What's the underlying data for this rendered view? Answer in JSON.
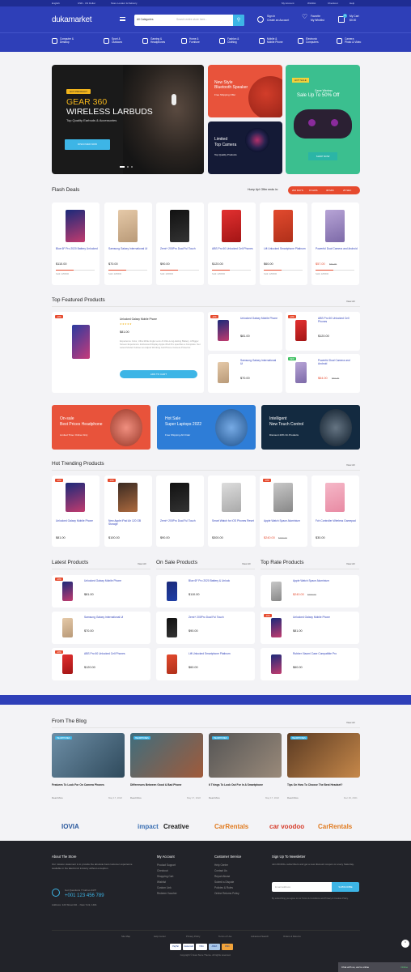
{
  "topbar": {
    "left": [
      "English",
      "USD - US Dollar",
      "Store Locator & Delivery"
    ],
    "right": [
      "My Account",
      "Wishlist",
      "Checkout",
      "Help"
    ]
  },
  "header": {
    "logo": "dukamarket",
    "search": {
      "category": "All Categories",
      "placeholder": "Search entire store here..."
    },
    "account": {
      "line1": "Sign In",
      "line2": "Create an Account"
    },
    "wishlist": {
      "line1": "Favorite",
      "line2": "My Wishlist"
    },
    "cart": {
      "line1": "My Cart",
      "line2": "$0.00",
      "count": "0"
    }
  },
  "categories": [
    {
      "l1": "Computer &",
      "l2": "Desktop"
    },
    {
      "l1": "Sport &",
      "l2": "Outdoors"
    },
    {
      "l1": "Gaming &",
      "l2": "Headphones"
    },
    {
      "l1": "Home &",
      "l2": "Furniture"
    },
    {
      "l1": "Fashion &",
      "l2": "Clothing"
    },
    {
      "l1": "Mobile &",
      "l2": "Mobile Phone"
    },
    {
      "l1": "Electronic",
      "l2": "Computers"
    },
    {
      "l1": "Camera",
      "l2": "Photo & Video"
    }
  ],
  "hero": {
    "tag": "HOT PRODUCT",
    "line1": "GEAR 360",
    "line2": "WIRELESS LARBUDS",
    "sub": "Top Quality Earbuds & Accessories",
    "cta": "DISCOVER NOW"
  },
  "banners": {
    "speaker": {
      "l1": "New Style",
      "l2": "Bluetooth Speaker",
      "l3": "Free Shipping Offer"
    },
    "camera": {
      "l1": "Limited",
      "l2": "Top Camera",
      "l3": "Top Quality Products"
    },
    "gamepad": {
      "tag": "HOT SALE",
      "l1": "Game Wireless",
      "l2": "Sale Up To 50% Off",
      "cta": "SHOP NOW"
    }
  },
  "flash": {
    "title": "Flash Deals",
    "offer": "Hurry Up! Offer ends in:",
    "timer": [
      "202 DAYS",
      "15 HRS",
      "38 MIN",
      "25 SEC"
    ],
    "products": [
      {
        "name": "Blue 6F Pro 2020 Battery Unlocked",
        "price": "$110.00",
        "sold": "Sold: 225/500",
        "fill": 0.45
      },
      {
        "name": "Samsung Galaxy International Ui",
        "price": "$70.00",
        "sold": "Sold: 225/500",
        "fill": 0.45
      },
      {
        "name": "Zemi+ 200Pro Dual Ful Touch",
        "price": "$90.00",
        "sold": "Sold: 225/500",
        "fill": 0.45
      },
      {
        "name": "ABS Pro 60 Unlocked Cell Phones",
        "price": "$120.00",
        "sold": "Sold: 225/500",
        "fill": 0.45
      },
      {
        "name": "Lift Unlocked Smartphone Platinum",
        "price": "$60.00",
        "sold": "Sold: 225/500",
        "fill": 0.45
      },
      {
        "name": "Powerful Dual Camera and Android",
        "price": "$57.00",
        "old": "$62.00",
        "sold": "Sold: 225/500",
        "fill": 0.45
      }
    ]
  },
  "featured": {
    "title": "Top Featured Products",
    "view": "View All",
    "main": {
      "badge": "-10%",
      "name": "Unlocked Galaxy Mobile Phone",
      "price": "$81.00",
      "desc": "Experience Color, Ultra-Wide Angle Lens & Ultra-Long-lasting Battery. A Bigger Screen Experience: Enhanced Display Apple iPod Pro specifies a Complete. Set Latest Model Outdoor as Adjust Working Cell Phone Camera Protector.",
      "cta": "ADD TO CART"
    },
    "items": [
      {
        "badge": "-10%",
        "name": "Unlocked Galaxy Mobile Phone",
        "price": "$81.00"
      },
      {
        "badge": "-10%",
        "name": "ABS Pro 60 Unlocked Cell Phones",
        "price": "$120.00"
      },
      {
        "badge": "",
        "name": "Samsung Galaxy International Ui",
        "price": "$70.00"
      },
      {
        "badge": "NEW",
        "name": "Powerful Dual Camera and Android",
        "price": "$64.00",
        "old": "$66.00"
      }
    ]
  },
  "promos": [
    {
      "l1": "On-sale",
      "l2": "Best Prices Headphone",
      "l3": "Limited Time: Online Only"
    },
    {
      "l1": "Hot Sale",
      "l2": "Super Laptops 2022",
      "l3": "Free Shipping All Order"
    },
    {
      "l1": "Intelligent",
      "l2": "New Touch Control",
      "l3": "Discount 20% On Products"
    }
  ],
  "trending": {
    "title": "Hot Trending Products",
    "view": "View All",
    "products": [
      {
        "badge": "-10%",
        "name": "Unlocked Galaxy Mobile Phone",
        "price": "$81.00"
      },
      {
        "badge": "-10%",
        "name": "New Apple iPad Air 120 GB Storage",
        "price": "$100.00"
      },
      {
        "badge": "",
        "name": "Zemi+ 200Pro Dual Ful Touch",
        "price": "$90.00"
      },
      {
        "badge": "",
        "name": "Smart Watch for iOS Phones Reset",
        "price": "$300.00"
      },
      {
        "badge": "-10%",
        "name": "Apple Watch Space Aluminium",
        "price": "$240.00",
        "old": "$260.00"
      },
      {
        "badge": "",
        "name": "Fch Controller Wireless Gamepad",
        "price": "$30.00"
      }
    ]
  },
  "lists": [
    {
      "title": "Latest Products",
      "view": "View All",
      "items": [
        {
          "badge": "-10%",
          "name": "Unlocked Galaxy Mobile Phone",
          "price": "$81.00"
        },
        {
          "badge": "",
          "name": "Samsung Galaxy International Ui",
          "price": "$70.00"
        },
        {
          "badge": "-10%",
          "name": "ABS Pro 60 Unlocked Cell Phones",
          "price": "$120.00"
        }
      ]
    },
    {
      "title": "On Sale Products",
      "view": "View All",
      "items": [
        {
          "badge": "",
          "name": "Blue 6F Pro 2020 Battery & Unlock",
          "price": "$110.00"
        },
        {
          "badge": "",
          "name": "Zemi+ 200Pro Dual Ful Touch",
          "price": "$90.00"
        },
        {
          "badge": "",
          "name": "Lift Unlocked Smartphone Platinum",
          "price": "$60.00"
        }
      ]
    },
    {
      "title": "Top Rate Products",
      "view": "View All",
      "items": [
        {
          "badge": "",
          "name": "Apple Watch Space Aluminium",
          "price": "$240.00",
          "old": "$260.00"
        },
        {
          "badge": "-10%",
          "name": "Unlocked Galaxy Mobile Phone",
          "price": "$81.00"
        },
        {
          "badge": "",
          "name": "Rubber Xiaomi Case Compatible Pro",
          "price": "$60.00"
        }
      ]
    }
  ],
  "blog": {
    "title": "From The Blog",
    "view": "View All",
    "posts": [
      {
        "tag": "HEADPHONES",
        "title": "Features To Look For On Camera Phones",
        "read": "Read More",
        "date": "May 17, 2022"
      },
      {
        "tag": "HEADPHONES",
        "title": "Differences Between Good & Bad Phone",
        "read": "Read More",
        "date": "May 17, 2022"
      },
      {
        "tag": "HEADPHONES",
        "title": "6 Things To Look Out For In A Smartphone",
        "read": "Read More",
        "date": "May 17, 2022"
      },
      {
        "tag": "HEADPHONES",
        "title": "Tips On How To Choose The Best Headset?",
        "read": "Read More",
        "date": "Dec 29, 2021"
      }
    ]
  },
  "brands": [
    "IOVIA",
    "impact",
    "Creative",
    "CarRentals",
    "car voodoo",
    "CarRentals"
  ],
  "footer": {
    "about": {
      "title": "About The Store",
      "text": "Our mission statement is to provide the absolute best customer experience available in the Electronic industry without exception.",
      "support": "Got Questions ? Call us 24/7!",
      "phone": "+001 123 456 789",
      "address": "Address: 123 Street Rd. - New York, 1401"
    },
    "account": {
      "title": "My Account",
      "links": "Product Support\nCheckout\nShopping Cart\nWishlist\nCustom Link\nRedeem Voucher"
    },
    "service": {
      "title": "Customer Service",
      "links": "Help Center\nContact Us\nReport Abuse\nSubmit a Dispute\nPolicies & Rules\nOnline Returns Policy"
    },
    "newsletter": {
      "title": "Sign Up To Newsletter",
      "text": "Join 60.000+ subscribers and get a new discount coupon on every Saturday.",
      "placeholder": "Email address",
      "button": "SUBSCRIBE",
      "note": "By subscribing you agree to our Terms & Conditions and Privacy & Cookies Policy."
    },
    "bottom_links": [
      "Site Map",
      "Help Center",
      "Privacy Policy",
      "Terms of Use",
      "Advanced Search",
      "Orders & Returns"
    ],
    "payments": [
      "PayPal",
      "mastercard",
      "VISA",
      "AMEX",
      "DISC"
    ],
    "copyright": "Copyright © Haui Store Theme. All rights reserved.",
    "chat": "Chat with us, we're online",
    "chat_status": "Online"
  },
  "colors": {
    "brand": "#2e3fb8",
    "accent": "#3db5e6",
    "sale": "#e64a2e",
    "star": "#f2b51c"
  }
}
